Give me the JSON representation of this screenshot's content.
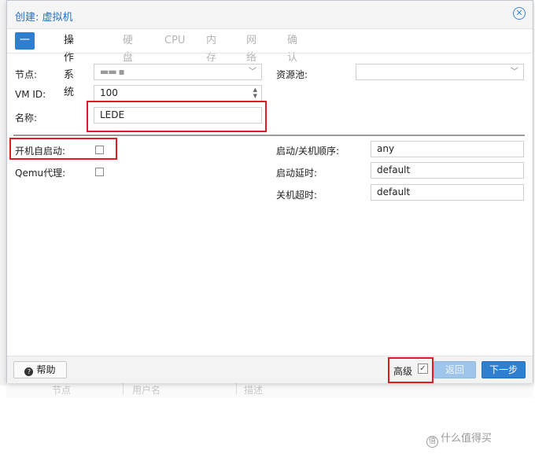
{
  "window": {
    "title": "创建: 虚拟机"
  },
  "tabs": [
    {
      "label": "一般",
      "state": "active"
    },
    {
      "label": "操作系统",
      "state": "enabled"
    },
    {
      "label": "硬盘",
      "state": "disabled"
    },
    {
      "label": "CPU",
      "state": "disabled"
    },
    {
      "label": "内存",
      "state": "disabled"
    },
    {
      "label": "网络",
      "state": "disabled"
    },
    {
      "label": "确认",
      "state": "disabled"
    }
  ],
  "form": {
    "node_label": "节点:",
    "node_value": "▬▬ ▪",
    "vmid_label": "VM ID:",
    "vmid_value": "100",
    "name_label": "名称:",
    "name_value": "LEDE",
    "pool_label": "资源池:",
    "pool_value": "",
    "onboot_label": "开机自启动:",
    "qemu_agent_label": "Qemu代理:",
    "startup_order_label": "启动/关机顺序:",
    "startup_order_value": "any",
    "startup_delay_label": "启动延时:",
    "startup_delay_value": "default",
    "shutdown_timeout_label": "关机超时:",
    "shutdown_timeout_value": "default"
  },
  "footer": {
    "help_label": "帮助",
    "advanced_label": "高级",
    "advanced_checked": true,
    "back_label": "返回",
    "next_label": "下一步"
  },
  "background": {
    "columns": [
      "节点",
      "用户名",
      "描述"
    ]
  },
  "watermark": {
    "text": "什么值得买"
  },
  "colors": {
    "accent": "#2f7fd0",
    "highlight": "#e11b22",
    "title": "#2a6fc0"
  }
}
